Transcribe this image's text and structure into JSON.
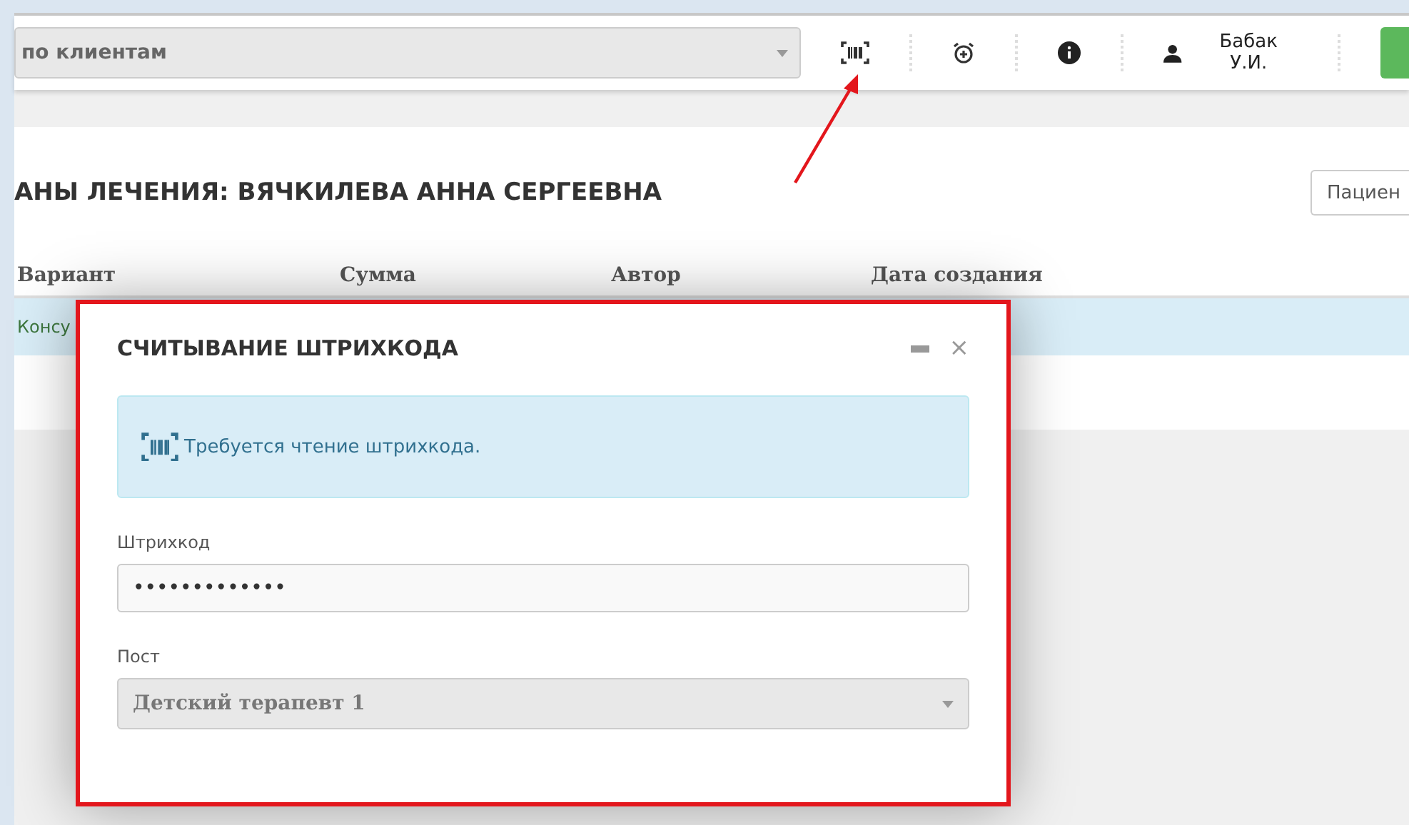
{
  "topbar": {
    "client_select": {
      "value": "по клиентам"
    },
    "user": {
      "name": "Бабак У.И."
    }
  },
  "page": {
    "title": "АНЫ ЛЕЧЕНИЯ: ВЯЧКИЛЕВА АННА СЕРГЕЕВНА",
    "patient_button": "Пациен",
    "table": {
      "columns": [
        "Вариант",
        "Сумма",
        "Автор",
        "Дата создания"
      ],
      "rows": [
        {
          "cells": [
            "Консу"
          ],
          "selected": true
        }
      ]
    }
  },
  "dialog": {
    "title": "СЧИТЫВАНИЕ ШТРИХКОДА",
    "close": "×",
    "info": "Требуется чтение штрихкода.",
    "fields": [
      {
        "kind": "input",
        "label": "Штрихкод",
        "value": "•••••••••••••"
      },
      {
        "kind": "select",
        "label": "Пост",
        "value": "Детский терапевт 1"
      }
    ]
  }
}
